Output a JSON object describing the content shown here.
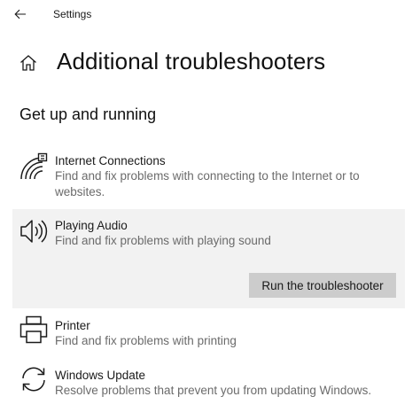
{
  "window": {
    "title": "Settings",
    "back_icon": "back-arrow-icon"
  },
  "header": {
    "title": "Additional troubleshooters",
    "icon": "home-icon"
  },
  "section": {
    "heading": "Get up and running"
  },
  "items": [
    {
      "icon": "wifi-signal-icon",
      "title": "Internet Connections",
      "description": "Find and fix problems with connecting to the Internet or to websites."
    },
    {
      "icon": "speaker-icon",
      "title": "Playing Audio",
      "description": "Find and fix problems with playing sound",
      "expanded": true,
      "action_label": "Run the troubleshooter"
    },
    {
      "icon": "printer-icon",
      "title": "Printer",
      "description": "Find and fix problems with printing"
    },
    {
      "icon": "sync-icon",
      "title": "Windows Update",
      "description": "Resolve problems that prevent you from updating Windows."
    }
  ],
  "colors": {
    "background": "#ffffff",
    "selected_row": "#f2f2f2",
    "button": "#cccccc",
    "description_text": "#6b6b6b",
    "primary_text": "#1a1a1a"
  }
}
